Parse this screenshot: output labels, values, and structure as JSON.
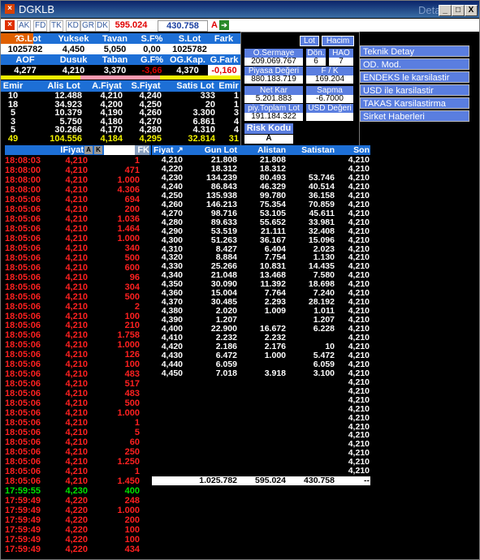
{
  "window": {
    "title": "DGKLB",
    "detail_label": "Detay",
    "min": "_",
    "max": "□",
    "close": "X"
  },
  "toolbar": {
    "tags": [
      "AK",
      "FD",
      "TK",
      "KD",
      "GR",
      "DK"
    ],
    "last_price": "595.024",
    "field2": "430.758",
    "a_label": "A"
  },
  "quote": {
    "row1_head": [
      "G.Lot",
      "Yuksek",
      "Tavan",
      "S.F%",
      "S.Lot",
      "Fark"
    ],
    "row1_vals": [
      "1025782",
      "4,450",
      "5,050",
      "0,00",
      "1025782",
      ""
    ],
    "row2_head": [
      "AOF",
      "Dusuk",
      "Taban",
      "G.F%",
      "OG.Kap.",
      "G.Fark"
    ],
    "row2_vals": [
      "4,277",
      "4,210",
      "3,370",
      "-3,66",
      "4,370",
      "-0,160"
    ],
    "depth_head": [
      "Emir",
      "Alis Lot",
      "A.Fiyat",
      "S.Fiyat",
      "Satis Lot",
      "Emir"
    ],
    "depth_rows": [
      [
        "10",
        "12.488",
        "4,210",
        "4,240",
        "333",
        "1"
      ],
      [
        "18",
        "34.923",
        "4,200",
        "4,250",
        "20",
        "1"
      ],
      [
        "5",
        "10.379",
        "4,190",
        "4,260",
        "3.300",
        "3"
      ],
      [
        "3",
        "5.750",
        "4,180",
        "4,270",
        "6.861",
        "4"
      ],
      [
        "5",
        "30.266",
        "4,170",
        "4,280",
        "4.310",
        "4"
      ]
    ],
    "depth_total": [
      "49",
      "104.556",
      "4,184",
      "4,295",
      "32.814",
      "31"
    ]
  },
  "info_panel": {
    "lot": "Lot",
    "hacim": "Hacim",
    "osermaye_label": "O.Sermaye",
    "osermaye": "209.069.767",
    "don_label": "Dön.",
    "don": "6",
    "hao_label": "HAO",
    "hao": "7",
    "piyasa_label": "Piyasa Değeri",
    "piyasa": "880.183.719",
    "fk_label": "F / K",
    "fk": "169.204",
    "netkar_label": "Net Kar",
    "netkar": "5.201.883",
    "sapma_label": "Sapma",
    "sapma": "-6.7000",
    "piy_label": "piy.Toplam Lot",
    "piy": "191.184.322",
    "usd_label": "USD Değeri",
    "risk_label": "Risk Kodu",
    "risk": "A"
  },
  "menu": [
    "Teknik Detay",
    "OD. Mod.",
    "ENDEKS le karsilastir",
    "USD ile karsilastir",
    "TAKAS Karsilastirma",
    "Sirket Haberleri"
  ],
  "trades_head": {
    "time": "",
    "price": "IFiyat",
    "lot": "FK"
  },
  "trades": [
    [
      "18:08:03",
      "4,210",
      "1",
      "r"
    ],
    [
      "18:08:00",
      "4,210",
      "471",
      "r"
    ],
    [
      "18:08:00",
      "4,210",
      "1.000",
      "r"
    ],
    [
      "18:08:00",
      "4,210",
      "4.306",
      "r"
    ],
    [
      "18:05:06",
      "4,210",
      "694",
      "r"
    ],
    [
      "18:05:06",
      "4,210",
      "200",
      "r"
    ],
    [
      "18:05:06",
      "4,210",
      "1.036",
      "r"
    ],
    [
      "18:05:06",
      "4,210",
      "1.464",
      "r"
    ],
    [
      "18:05:06",
      "4,210",
      "1.000",
      "r"
    ],
    [
      "18:05:06",
      "4,210",
      "340",
      "r"
    ],
    [
      "18:05:06",
      "4,210",
      "500",
      "r"
    ],
    [
      "18:05:06",
      "4,210",
      "600",
      "r"
    ],
    [
      "18:05:06",
      "4,210",
      "96",
      "r"
    ],
    [
      "18:05:06",
      "4,210",
      "304",
      "r"
    ],
    [
      "18:05:06",
      "4,210",
      "500",
      "r"
    ],
    [
      "18:05:06",
      "4,210",
      "2",
      "r"
    ],
    [
      "18:05:06",
      "4,210",
      "100",
      "r"
    ],
    [
      "18:05:06",
      "4,210",
      "210",
      "r"
    ],
    [
      "18:05:06",
      "4,210",
      "1.758",
      "r"
    ],
    [
      "18:05:06",
      "4,210",
      "1.000",
      "r"
    ],
    [
      "18:05:06",
      "4,210",
      "126",
      "r"
    ],
    [
      "18:05:06",
      "4,210",
      "100",
      "r"
    ],
    [
      "18:05:06",
      "4,210",
      "483",
      "r"
    ],
    [
      "18:05:06",
      "4,210",
      "517",
      "r"
    ],
    [
      "18:05:06",
      "4,210",
      "483",
      "r"
    ],
    [
      "18:05:06",
      "4,210",
      "500",
      "r"
    ],
    [
      "18:05:06",
      "4,210",
      "1.000",
      "r"
    ],
    [
      "18:05:06",
      "4,210",
      "1",
      "r"
    ],
    [
      "18:05:06",
      "4,210",
      "5",
      "r"
    ],
    [
      "18:05:06",
      "4,210",
      "60",
      "r"
    ],
    [
      "18:05:06",
      "4,210",
      "250",
      "r"
    ],
    [
      "18:05:06",
      "4,210",
      "1.250",
      "r"
    ],
    [
      "18:05:06",
      "4,210",
      "1",
      "r"
    ],
    [
      "18:05:06",
      "4,210",
      "1.450",
      "r"
    ],
    [
      "17:59:55",
      "4,230",
      "400",
      "g"
    ],
    [
      "17:59:49",
      "4,220",
      "248",
      "r"
    ],
    [
      "17:59:49",
      "4,220",
      "1.000",
      "r"
    ],
    [
      "17:59:49",
      "4,220",
      "200",
      "r"
    ],
    [
      "17:59:49",
      "4,220",
      "100",
      "r"
    ],
    [
      "17:59:49",
      "4,220",
      "100",
      "r"
    ],
    [
      "17:59:49",
      "4,220",
      "434",
      "r"
    ]
  ],
  "price_head": [
    "Fiyat",
    "Gun Lot",
    "Alistan",
    "Satistan",
    "Son"
  ],
  "price_rows": [
    [
      "4,210",
      "21.808",
      "21.808",
      "",
      "4,210"
    ],
    [
      "4,220",
      "18.312",
      "18.312",
      "",
      "4,210"
    ],
    [
      "4,230",
      "134.239",
      "80.493",
      "53.746",
      "4,210"
    ],
    [
      "4,240",
      "86.843",
      "46.329",
      "40.514",
      "4,210"
    ],
    [
      "4,250",
      "135.938",
      "99.780",
      "36.158",
      "4,210"
    ],
    [
      "4,260",
      "146.213",
      "75.354",
      "70.859",
      "4,210"
    ],
    [
      "4,270",
      "98.716",
      "53.105",
      "45.611",
      "4,210"
    ],
    [
      "4,280",
      "89.633",
      "55.652",
      "33.981",
      "4,210"
    ],
    [
      "4,290",
      "53.519",
      "21.111",
      "32.408",
      "4,210"
    ],
    [
      "4,300",
      "51.263",
      "36.167",
      "15.096",
      "4,210"
    ],
    [
      "4,310",
      "8.427",
      "6.404",
      "2.023",
      "4,210"
    ],
    [
      "4,320",
      "8.884",
      "7.754",
      "1.130",
      "4,210"
    ],
    [
      "4,330",
      "25.266",
      "10.831",
      "14.435",
      "4,210"
    ],
    [
      "4,340",
      "21.048",
      "13.468",
      "7.580",
      "4,210"
    ],
    [
      "4,350",
      "30.090",
      "11.392",
      "18.698",
      "4,210"
    ],
    [
      "4,360",
      "15.004",
      "7.764",
      "7.240",
      "4,210"
    ],
    [
      "4,370",
      "30.485",
      "2.293",
      "28.192",
      "4,210"
    ],
    [
      "4,380",
      "2.020",
      "1.009",
      "1.011",
      "4,210"
    ],
    [
      "4,390",
      "1.207",
      "",
      "1.207",
      "4,210"
    ],
    [
      "4,400",
      "22.900",
      "16.672",
      "6.228",
      "4,210"
    ],
    [
      "4,410",
      "2.232",
      "2.232",
      "",
      "4,210"
    ],
    [
      "4,420",
      "2.186",
      "2.176",
      "10",
      "4,210"
    ],
    [
      "4,430",
      "6.472",
      "1.000",
      "5.472",
      "4,210"
    ],
    [
      "4,440",
      "6.059",
      "",
      "6.059",
      "4,210"
    ],
    [
      "4,450",
      "7.018",
      "3.918",
      "3.100",
      "4,210"
    ],
    [
      "",
      "",
      "",
      "",
      "4,210"
    ],
    [
      "",
      "",
      "",
      "",
      "4,210"
    ],
    [
      "",
      "",
      "",
      "",
      "4,210"
    ],
    [
      "",
      "",
      "",
      "",
      "4,210"
    ],
    [
      "",
      "",
      "",
      "",
      "4,210"
    ],
    [
      "",
      "",
      "",
      "",
      "4,210"
    ],
    [
      "",
      "",
      "",
      "",
      "4,210"
    ],
    [
      "",
      "",
      "",
      "",
      "4,210"
    ],
    [
      "",
      "",
      "",
      "",
      "4,210"
    ],
    [
      "",
      "",
      "",
      "",
      "4,210"
    ],
    [
      "",
      "",
      "",
      "",
      "4,210"
    ]
  ],
  "price_total": [
    "",
    "1.025.782",
    "595.024",
    "430.758",
    "--"
  ]
}
